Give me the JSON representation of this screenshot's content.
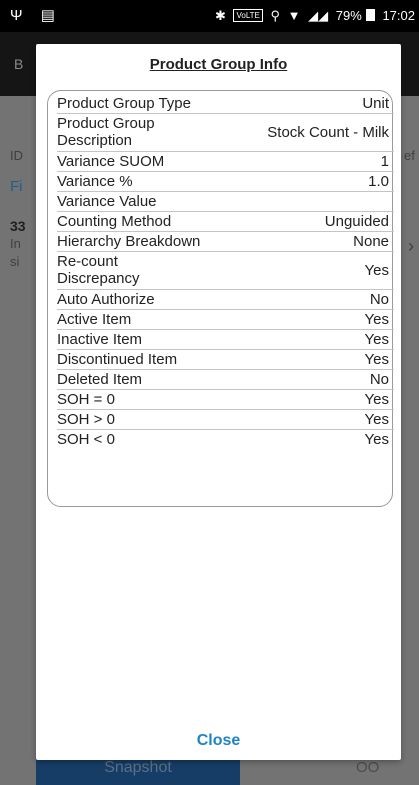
{
  "status_bar": {
    "battery": "79%",
    "time": "17:02",
    "network": "VoLTE"
  },
  "dialog": {
    "title": "Product Group Info",
    "close_label": "Close",
    "rows": [
      {
        "label": "Product Group Type",
        "value": "Unit"
      },
      {
        "label": "Product Group Description",
        "value": "Stock Count - Milk"
      },
      {
        "label": "Variance SUOM",
        "value": "1"
      },
      {
        "label": "Variance %",
        "value": "1.0"
      },
      {
        "label": "Variance Value",
        "value": ""
      },
      {
        "label": "Counting Method",
        "value": "Unguided"
      },
      {
        "label": "Hierarchy Breakdown",
        "value": "None"
      },
      {
        "label": "Re-count Discrepancy",
        "value": "Yes"
      },
      {
        "label": "Auto Authorize",
        "value": "No"
      },
      {
        "label": "Active Item",
        "value": "Yes"
      },
      {
        "label": "Inactive Item",
        "value": "Yes"
      },
      {
        "label": "Discontinued Item",
        "value": "Yes"
      },
      {
        "label": "Deleted Item",
        "value": "No"
      },
      {
        "label": "SOH = 0",
        "value": "Yes"
      },
      {
        "label": "SOH > 0",
        "value": "Yes"
      },
      {
        "label": "SOH < 0",
        "value": "Yes"
      }
    ]
  },
  "background": {
    "header_fragment": "B",
    "id_fragment": "ID",
    "filter_fragment": "Fi",
    "ref_fragment": "ef",
    "count_fragment": "33",
    "line_fragment_1": "In",
    "line_fragment_2": "si",
    "chevron": "›",
    "button_label": "Snapshot",
    "right_fragment": "OO"
  }
}
